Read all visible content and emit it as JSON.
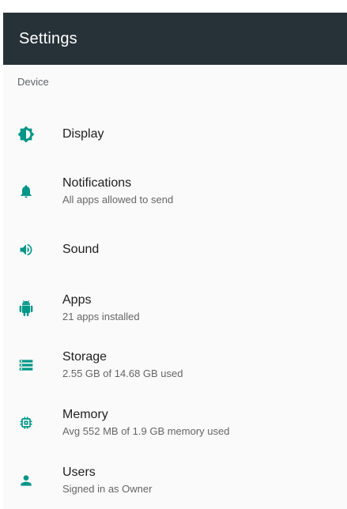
{
  "app": {
    "title": "Settings"
  },
  "section": {
    "label": "Device"
  },
  "colors": {
    "toolbar": "#263238",
    "accent": "#009688"
  },
  "items": [
    {
      "id": "display",
      "icon": "display-brightness-icon",
      "title": "Display",
      "summary": ""
    },
    {
      "id": "notifications",
      "icon": "bell-icon",
      "title": "Notifications",
      "summary": "All apps allowed to send"
    },
    {
      "id": "sound",
      "icon": "speaker-icon",
      "title": "Sound",
      "summary": ""
    },
    {
      "id": "apps",
      "icon": "android-icon",
      "title": "Apps",
      "summary": "21 apps installed"
    },
    {
      "id": "storage",
      "icon": "storage-icon",
      "title": "Storage",
      "summary": "2.55 GB of 14.68 GB used"
    },
    {
      "id": "memory",
      "icon": "memory-chip-icon",
      "title": "Memory",
      "summary": "Avg 552 MB of 1.9 GB memory used"
    },
    {
      "id": "users",
      "icon": "person-icon",
      "title": "Users",
      "summary": "Signed in as Owner"
    }
  ]
}
